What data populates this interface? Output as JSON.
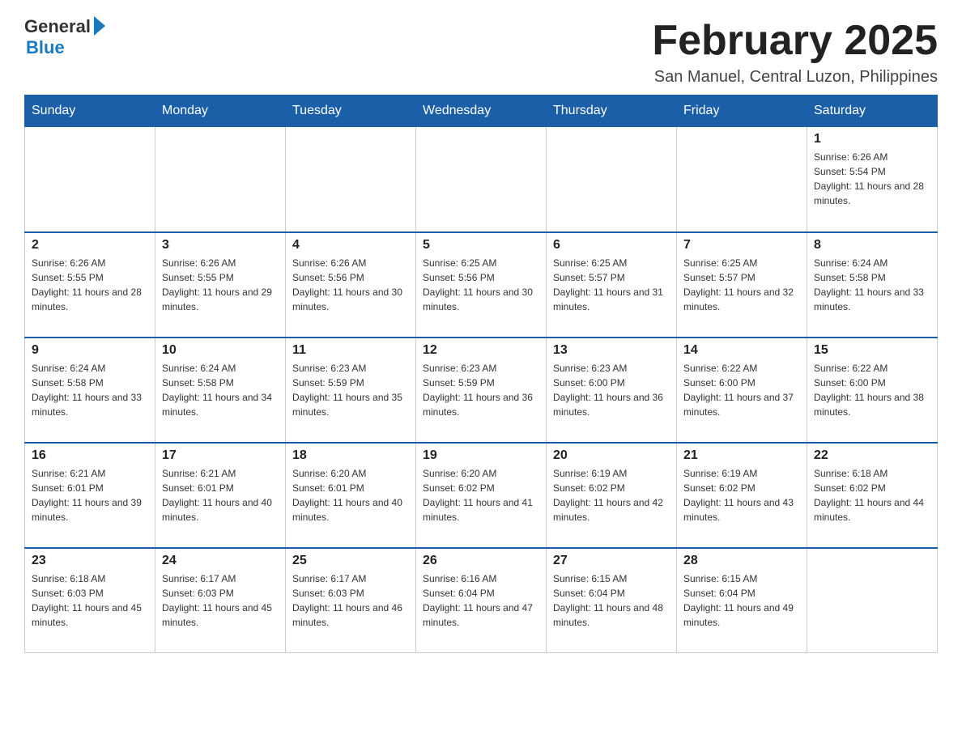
{
  "header": {
    "logo_general": "General",
    "logo_blue": "Blue",
    "month_title": "February 2025",
    "location": "San Manuel, Central Luzon, Philippines"
  },
  "weekdays": [
    "Sunday",
    "Monday",
    "Tuesday",
    "Wednesday",
    "Thursday",
    "Friday",
    "Saturday"
  ],
  "weeks": [
    [
      {
        "day": "",
        "sunrise": "",
        "sunset": "",
        "daylight": ""
      },
      {
        "day": "",
        "sunrise": "",
        "sunset": "",
        "daylight": ""
      },
      {
        "day": "",
        "sunrise": "",
        "sunset": "",
        "daylight": ""
      },
      {
        "day": "",
        "sunrise": "",
        "sunset": "",
        "daylight": ""
      },
      {
        "day": "",
        "sunrise": "",
        "sunset": "",
        "daylight": ""
      },
      {
        "day": "",
        "sunrise": "",
        "sunset": "",
        "daylight": ""
      },
      {
        "day": "1",
        "sunrise": "Sunrise: 6:26 AM",
        "sunset": "Sunset: 5:54 PM",
        "daylight": "Daylight: 11 hours and 28 minutes."
      }
    ],
    [
      {
        "day": "2",
        "sunrise": "Sunrise: 6:26 AM",
        "sunset": "Sunset: 5:55 PM",
        "daylight": "Daylight: 11 hours and 28 minutes."
      },
      {
        "day": "3",
        "sunrise": "Sunrise: 6:26 AM",
        "sunset": "Sunset: 5:55 PM",
        "daylight": "Daylight: 11 hours and 29 minutes."
      },
      {
        "day": "4",
        "sunrise": "Sunrise: 6:26 AM",
        "sunset": "Sunset: 5:56 PM",
        "daylight": "Daylight: 11 hours and 30 minutes."
      },
      {
        "day": "5",
        "sunrise": "Sunrise: 6:25 AM",
        "sunset": "Sunset: 5:56 PM",
        "daylight": "Daylight: 11 hours and 30 minutes."
      },
      {
        "day": "6",
        "sunrise": "Sunrise: 6:25 AM",
        "sunset": "Sunset: 5:57 PM",
        "daylight": "Daylight: 11 hours and 31 minutes."
      },
      {
        "day": "7",
        "sunrise": "Sunrise: 6:25 AM",
        "sunset": "Sunset: 5:57 PM",
        "daylight": "Daylight: 11 hours and 32 minutes."
      },
      {
        "day": "8",
        "sunrise": "Sunrise: 6:24 AM",
        "sunset": "Sunset: 5:58 PM",
        "daylight": "Daylight: 11 hours and 33 minutes."
      }
    ],
    [
      {
        "day": "9",
        "sunrise": "Sunrise: 6:24 AM",
        "sunset": "Sunset: 5:58 PM",
        "daylight": "Daylight: 11 hours and 33 minutes."
      },
      {
        "day": "10",
        "sunrise": "Sunrise: 6:24 AM",
        "sunset": "Sunset: 5:58 PM",
        "daylight": "Daylight: 11 hours and 34 minutes."
      },
      {
        "day": "11",
        "sunrise": "Sunrise: 6:23 AM",
        "sunset": "Sunset: 5:59 PM",
        "daylight": "Daylight: 11 hours and 35 minutes."
      },
      {
        "day": "12",
        "sunrise": "Sunrise: 6:23 AM",
        "sunset": "Sunset: 5:59 PM",
        "daylight": "Daylight: 11 hours and 36 minutes."
      },
      {
        "day": "13",
        "sunrise": "Sunrise: 6:23 AM",
        "sunset": "Sunset: 6:00 PM",
        "daylight": "Daylight: 11 hours and 36 minutes."
      },
      {
        "day": "14",
        "sunrise": "Sunrise: 6:22 AM",
        "sunset": "Sunset: 6:00 PM",
        "daylight": "Daylight: 11 hours and 37 minutes."
      },
      {
        "day": "15",
        "sunrise": "Sunrise: 6:22 AM",
        "sunset": "Sunset: 6:00 PM",
        "daylight": "Daylight: 11 hours and 38 minutes."
      }
    ],
    [
      {
        "day": "16",
        "sunrise": "Sunrise: 6:21 AM",
        "sunset": "Sunset: 6:01 PM",
        "daylight": "Daylight: 11 hours and 39 minutes."
      },
      {
        "day": "17",
        "sunrise": "Sunrise: 6:21 AM",
        "sunset": "Sunset: 6:01 PM",
        "daylight": "Daylight: 11 hours and 40 minutes."
      },
      {
        "day": "18",
        "sunrise": "Sunrise: 6:20 AM",
        "sunset": "Sunset: 6:01 PM",
        "daylight": "Daylight: 11 hours and 40 minutes."
      },
      {
        "day": "19",
        "sunrise": "Sunrise: 6:20 AM",
        "sunset": "Sunset: 6:02 PM",
        "daylight": "Daylight: 11 hours and 41 minutes."
      },
      {
        "day": "20",
        "sunrise": "Sunrise: 6:19 AM",
        "sunset": "Sunset: 6:02 PM",
        "daylight": "Daylight: 11 hours and 42 minutes."
      },
      {
        "day": "21",
        "sunrise": "Sunrise: 6:19 AM",
        "sunset": "Sunset: 6:02 PM",
        "daylight": "Daylight: 11 hours and 43 minutes."
      },
      {
        "day": "22",
        "sunrise": "Sunrise: 6:18 AM",
        "sunset": "Sunset: 6:02 PM",
        "daylight": "Daylight: 11 hours and 44 minutes."
      }
    ],
    [
      {
        "day": "23",
        "sunrise": "Sunrise: 6:18 AM",
        "sunset": "Sunset: 6:03 PM",
        "daylight": "Daylight: 11 hours and 45 minutes."
      },
      {
        "day": "24",
        "sunrise": "Sunrise: 6:17 AM",
        "sunset": "Sunset: 6:03 PM",
        "daylight": "Daylight: 11 hours and 45 minutes."
      },
      {
        "day": "25",
        "sunrise": "Sunrise: 6:17 AM",
        "sunset": "Sunset: 6:03 PM",
        "daylight": "Daylight: 11 hours and 46 minutes."
      },
      {
        "day": "26",
        "sunrise": "Sunrise: 6:16 AM",
        "sunset": "Sunset: 6:04 PM",
        "daylight": "Daylight: 11 hours and 47 minutes."
      },
      {
        "day": "27",
        "sunrise": "Sunrise: 6:15 AM",
        "sunset": "Sunset: 6:04 PM",
        "daylight": "Daylight: 11 hours and 48 minutes."
      },
      {
        "day": "28",
        "sunrise": "Sunrise: 6:15 AM",
        "sunset": "Sunset: 6:04 PM",
        "daylight": "Daylight: 11 hours and 49 minutes."
      },
      {
        "day": "",
        "sunrise": "",
        "sunset": "",
        "daylight": ""
      }
    ]
  ]
}
